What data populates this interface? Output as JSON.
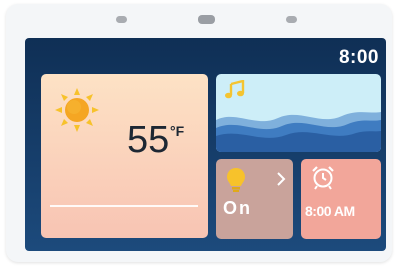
{
  "status_bar": {
    "time": "8:00"
  },
  "weather": {
    "icon": "sun-icon",
    "temperature": "55",
    "unit": "°F"
  },
  "music": {
    "icon": "music-note-icon"
  },
  "light": {
    "icon": "lightbulb-icon",
    "status": "On"
  },
  "alarm": {
    "icon": "alarm-clock-icon",
    "time": "8:00 AM"
  },
  "colors": {
    "screen_bg": "#12365f",
    "weather_card": "#fbd5bd",
    "music_card": "#cdeef8",
    "light_card": "#c9a39b",
    "alarm_card": "#f2a69a",
    "accent_yellow": "#f7c22b"
  }
}
